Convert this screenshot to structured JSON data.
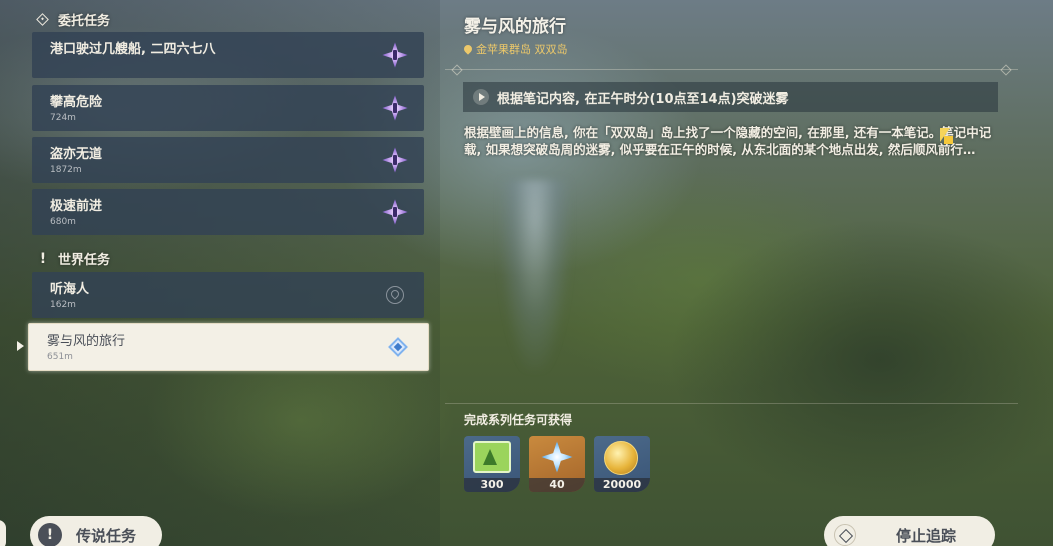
{
  "commission_section": {
    "header": "委托任务",
    "icon": "commission-diamond-icon",
    "quests": [
      {
        "title": "港口驶过几艘船, 二四六七八",
        "distance": ""
      },
      {
        "title": "攀高危险",
        "distance": "724m"
      },
      {
        "title": "盗亦无道",
        "distance": "1872m"
      },
      {
        "title": "极速前进",
        "distance": "680m"
      }
    ]
  },
  "world_section": {
    "header": "世界任务",
    "icon": "exclamation-icon",
    "quests": [
      {
        "title": "听海人",
        "distance": "162m"
      },
      {
        "title": "雾与风的旅行",
        "distance": "651m"
      }
    ]
  },
  "detail": {
    "title": "雾与风的旅行",
    "location": "金苹果群岛 双双岛",
    "objective": "根据笔记内容, 在正午时分(10点至14点)突破迷雾",
    "description": "根据壁画上的信息, 你在「双双岛」岛上找了一个隐藏的空间, 在那里, 还有一本笔记。笔记中记载, 如果想突破岛周的迷雾, 似乎要在正午的时候, 从东北面的某个地点出发, 然后顺风前行…",
    "rewards_label": "完成系列任务可获得",
    "rewards": [
      {
        "icon": "adventure-exp-icon",
        "count": "300"
      },
      {
        "icon": "primogem-icon",
        "count": "40"
      },
      {
        "icon": "mora-icon",
        "count": "20000"
      }
    ]
  },
  "buttons": {
    "legend_quests": "传说任务",
    "stop_tracking": "停止追踪"
  },
  "colors": {
    "location_gold": "#ecc86a",
    "card_bg": "#324254",
    "selected_bg": "#f3f0e6"
  }
}
